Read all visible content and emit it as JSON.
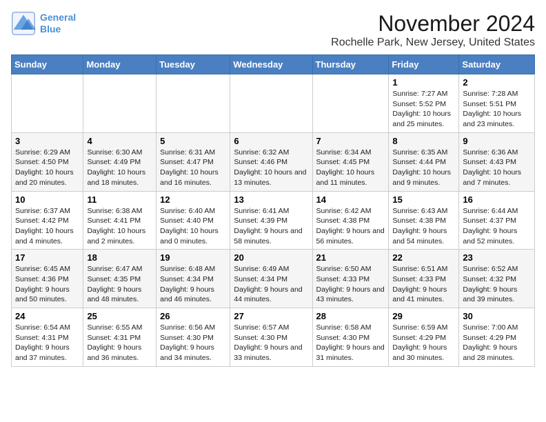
{
  "logo": {
    "line1": "General",
    "line2": "Blue"
  },
  "title": "November 2024",
  "location": "Rochelle Park, New Jersey, United States",
  "days_of_week": [
    "Sunday",
    "Monday",
    "Tuesday",
    "Wednesday",
    "Thursday",
    "Friday",
    "Saturday"
  ],
  "weeks": [
    [
      {
        "day": "",
        "info": ""
      },
      {
        "day": "",
        "info": ""
      },
      {
        "day": "",
        "info": ""
      },
      {
        "day": "",
        "info": ""
      },
      {
        "day": "",
        "info": ""
      },
      {
        "day": "1",
        "info": "Sunrise: 7:27 AM\nSunset: 5:52 PM\nDaylight: 10 hours and 25 minutes."
      },
      {
        "day": "2",
        "info": "Sunrise: 7:28 AM\nSunset: 5:51 PM\nDaylight: 10 hours and 23 minutes."
      }
    ],
    [
      {
        "day": "3",
        "info": "Sunrise: 6:29 AM\nSunset: 4:50 PM\nDaylight: 10 hours and 20 minutes."
      },
      {
        "day": "4",
        "info": "Sunrise: 6:30 AM\nSunset: 4:49 PM\nDaylight: 10 hours and 18 minutes."
      },
      {
        "day": "5",
        "info": "Sunrise: 6:31 AM\nSunset: 4:47 PM\nDaylight: 10 hours and 16 minutes."
      },
      {
        "day": "6",
        "info": "Sunrise: 6:32 AM\nSunset: 4:46 PM\nDaylight: 10 hours and 13 minutes."
      },
      {
        "day": "7",
        "info": "Sunrise: 6:34 AM\nSunset: 4:45 PM\nDaylight: 10 hours and 11 minutes."
      },
      {
        "day": "8",
        "info": "Sunrise: 6:35 AM\nSunset: 4:44 PM\nDaylight: 10 hours and 9 minutes."
      },
      {
        "day": "9",
        "info": "Sunrise: 6:36 AM\nSunset: 4:43 PM\nDaylight: 10 hours and 7 minutes."
      }
    ],
    [
      {
        "day": "10",
        "info": "Sunrise: 6:37 AM\nSunset: 4:42 PM\nDaylight: 10 hours and 4 minutes."
      },
      {
        "day": "11",
        "info": "Sunrise: 6:38 AM\nSunset: 4:41 PM\nDaylight: 10 hours and 2 minutes."
      },
      {
        "day": "12",
        "info": "Sunrise: 6:40 AM\nSunset: 4:40 PM\nDaylight: 10 hours and 0 minutes."
      },
      {
        "day": "13",
        "info": "Sunrise: 6:41 AM\nSunset: 4:39 PM\nDaylight: 9 hours and 58 minutes."
      },
      {
        "day": "14",
        "info": "Sunrise: 6:42 AM\nSunset: 4:38 PM\nDaylight: 9 hours and 56 minutes."
      },
      {
        "day": "15",
        "info": "Sunrise: 6:43 AM\nSunset: 4:38 PM\nDaylight: 9 hours and 54 minutes."
      },
      {
        "day": "16",
        "info": "Sunrise: 6:44 AM\nSunset: 4:37 PM\nDaylight: 9 hours and 52 minutes."
      }
    ],
    [
      {
        "day": "17",
        "info": "Sunrise: 6:45 AM\nSunset: 4:36 PM\nDaylight: 9 hours and 50 minutes."
      },
      {
        "day": "18",
        "info": "Sunrise: 6:47 AM\nSunset: 4:35 PM\nDaylight: 9 hours and 48 minutes."
      },
      {
        "day": "19",
        "info": "Sunrise: 6:48 AM\nSunset: 4:34 PM\nDaylight: 9 hours and 46 minutes."
      },
      {
        "day": "20",
        "info": "Sunrise: 6:49 AM\nSunset: 4:34 PM\nDaylight: 9 hours and 44 minutes."
      },
      {
        "day": "21",
        "info": "Sunrise: 6:50 AM\nSunset: 4:33 PM\nDaylight: 9 hours and 43 minutes."
      },
      {
        "day": "22",
        "info": "Sunrise: 6:51 AM\nSunset: 4:33 PM\nDaylight: 9 hours and 41 minutes."
      },
      {
        "day": "23",
        "info": "Sunrise: 6:52 AM\nSunset: 4:32 PM\nDaylight: 9 hours and 39 minutes."
      }
    ],
    [
      {
        "day": "24",
        "info": "Sunrise: 6:54 AM\nSunset: 4:31 PM\nDaylight: 9 hours and 37 minutes."
      },
      {
        "day": "25",
        "info": "Sunrise: 6:55 AM\nSunset: 4:31 PM\nDaylight: 9 hours and 36 minutes."
      },
      {
        "day": "26",
        "info": "Sunrise: 6:56 AM\nSunset: 4:30 PM\nDaylight: 9 hours and 34 minutes."
      },
      {
        "day": "27",
        "info": "Sunrise: 6:57 AM\nSunset: 4:30 PM\nDaylight: 9 hours and 33 minutes."
      },
      {
        "day": "28",
        "info": "Sunrise: 6:58 AM\nSunset: 4:30 PM\nDaylight: 9 hours and 31 minutes."
      },
      {
        "day": "29",
        "info": "Sunrise: 6:59 AM\nSunset: 4:29 PM\nDaylight: 9 hours and 30 minutes."
      },
      {
        "day": "30",
        "info": "Sunrise: 7:00 AM\nSunset: 4:29 PM\nDaylight: 9 hours and 28 minutes."
      }
    ]
  ]
}
